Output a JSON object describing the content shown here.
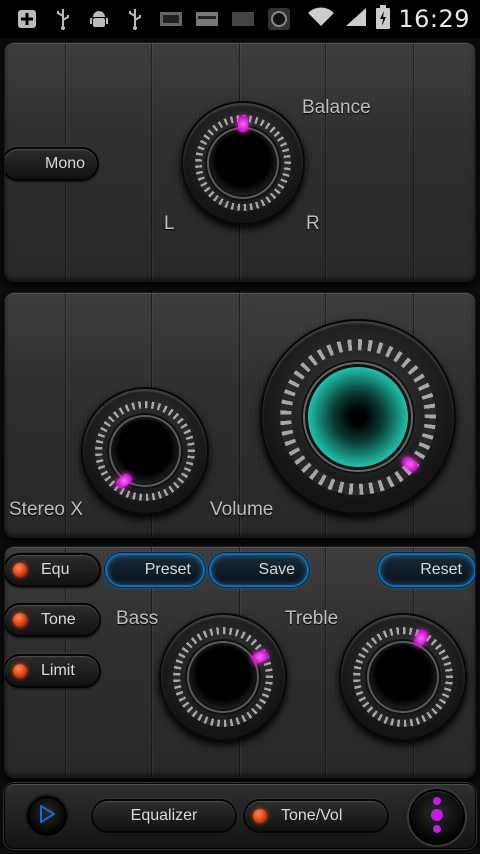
{
  "status_bar": {
    "time": "16:29",
    "icons": [
      "add-icon",
      "usb-icon",
      "android-debug-icon",
      "usb-icon",
      "app-notification-icon",
      "app-notification-icon",
      "app-notification-icon",
      "app-notification-icon",
      "wifi-icon",
      "signal-icon",
      "battery-charging-icon"
    ]
  },
  "balance_panel": {
    "title": "Balance",
    "left_label": "L",
    "right_label": "R",
    "mono_button": "Mono"
  },
  "volume_panel": {
    "stereo_label": "Stereo X",
    "volume_label": "Volume"
  },
  "eq_panel": {
    "equ_button": "Equ",
    "tone_button": "Tone",
    "limit_button": "Limit",
    "preset_button": "Preset",
    "save_button": "Save",
    "reset_button": "Reset",
    "bass_label": "Bass",
    "treble_label": "Treble"
  },
  "bottom_bar": {
    "equalizer_tab": "Equalizer",
    "tonevol_tab": "Tone/Vol"
  },
  "colors": {
    "accent_teal": "#1fbfa8",
    "indicator_magenta": "#e020e0",
    "led_orange": "#e04515",
    "button_glow_blue": "#0d6fb0"
  }
}
